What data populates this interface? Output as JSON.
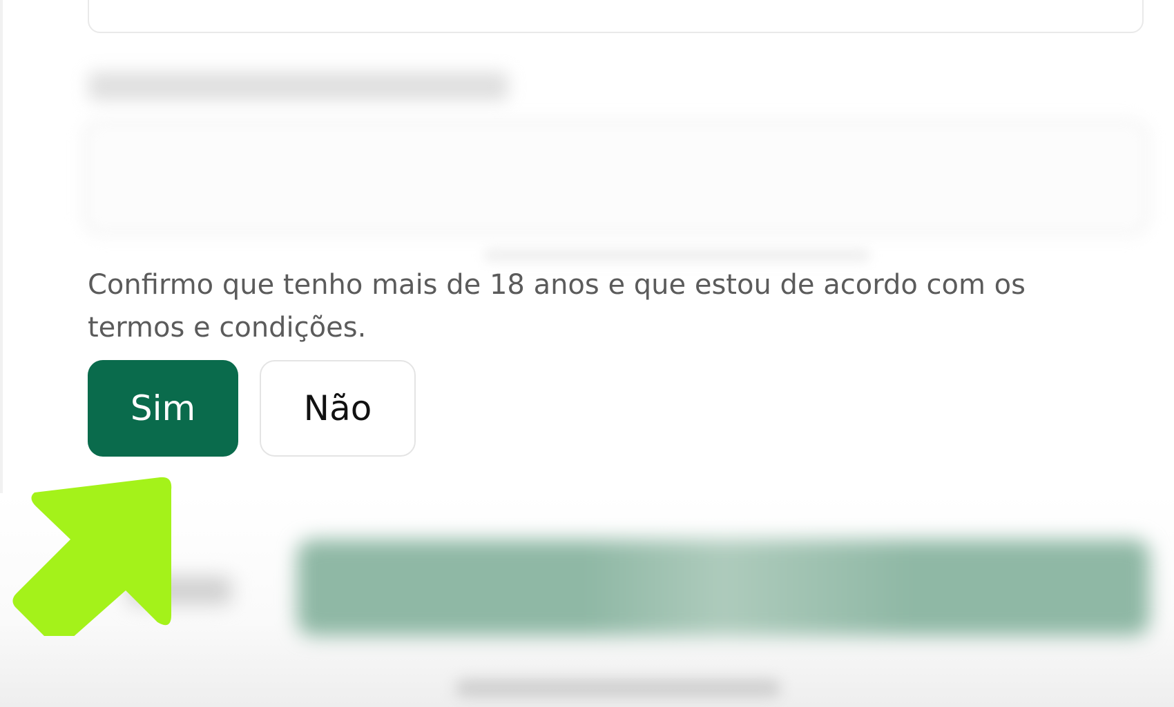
{
  "confirmation": {
    "text": "Confirmo que tenho mais de 18 anos e que estou de acordo com os termos e condições."
  },
  "choices": {
    "yes_label": "Sim",
    "no_label": "Não",
    "selected": "Sim"
  },
  "colors": {
    "primary_green": "#0a6b4c",
    "arrow_highlight": "#a4f21a",
    "text_gray": "#5b5b5b"
  },
  "icons": {
    "pointer": "arrow-up-left-icon"
  }
}
